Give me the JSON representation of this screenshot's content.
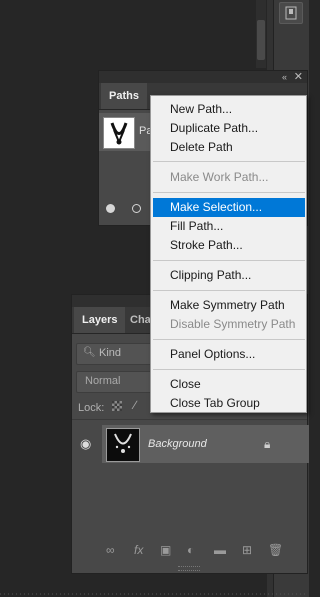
{
  "paths_panel": {
    "tab_label": "Paths",
    "path_label": "Pa",
    "collapse_icon": "double-chevron-icon",
    "menu_icon": "hamburger-icon"
  },
  "context_menu": {
    "items": [
      {
        "label": "New Path...",
        "state": "enabled"
      },
      {
        "label": "Duplicate Path...",
        "state": "enabled"
      },
      {
        "label": "Delete Path",
        "state": "enabled"
      },
      {
        "label": "Make Work Path...",
        "state": "disabled"
      },
      {
        "label": "Make Selection...",
        "state": "highlighted"
      },
      {
        "label": "Fill Path...",
        "state": "enabled"
      },
      {
        "label": "Stroke Path...",
        "state": "enabled"
      },
      {
        "label": "Clipping Path...",
        "state": "enabled"
      },
      {
        "label": "Make Symmetry Path",
        "state": "enabled"
      },
      {
        "label": "Disable Symmetry Path",
        "state": "disabled"
      },
      {
        "label": "Panel Options...",
        "state": "enabled"
      },
      {
        "label": "Close",
        "state": "enabled"
      },
      {
        "label": "Close Tab Group",
        "state": "enabled"
      }
    ],
    "highlight_color": "#0078d7"
  },
  "layers_panel": {
    "tab_label": "Layers",
    "second_tab_label": "Cha",
    "kind_filter": "Kind",
    "blend_mode": "Normal",
    "lock_label": "Lock:",
    "layer": {
      "name": "Background",
      "visible": true,
      "locked": true
    }
  },
  "colors": {
    "background": "#262626",
    "panel": "#484848",
    "menu_background": "#f0f0f0"
  }
}
